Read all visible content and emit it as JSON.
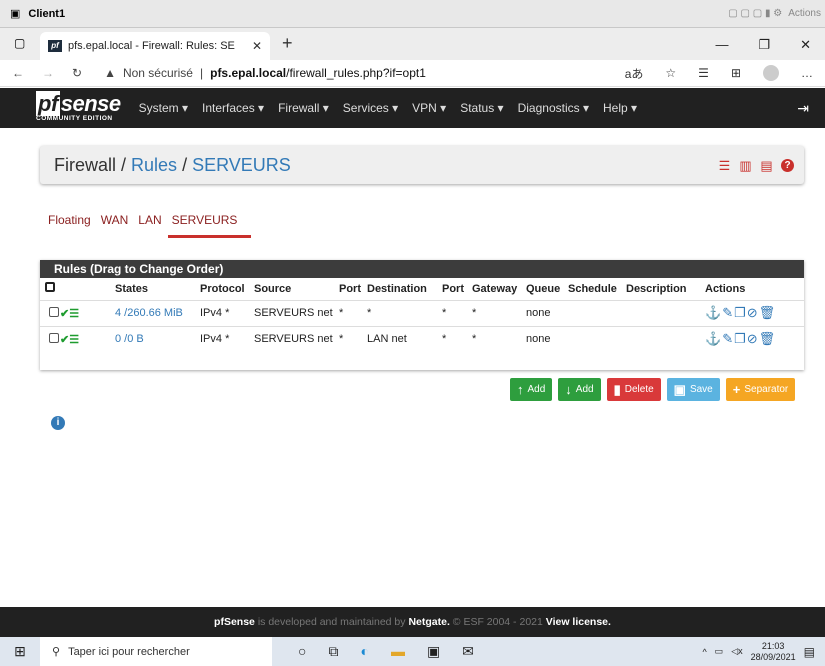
{
  "vm": {
    "title": "Client1",
    "actions": "Actions"
  },
  "browser": {
    "tab_title": "pfs.epal.local - Firewall: Rules: SE",
    "tab_favicon": "pf",
    "insecure_label": "Non sécurisé",
    "url_host": "pfs.epal.local",
    "url_path": "/firewall_rules.php?if=opt1"
  },
  "logo": {
    "name": "sense",
    "prefix": "pf",
    "edition": "COMMUNITY EDITION"
  },
  "nav": {
    "items": [
      "System ▾",
      "Interfaces ▾",
      "Firewall ▾",
      "Services ▾",
      "VPN ▾",
      "Status ▾",
      "Diagnostics ▾",
      "Help ▾"
    ]
  },
  "breadcrumb": {
    "root": "Firewall",
    "section": "Rules",
    "current": "SERVEURS",
    "sep": "/"
  },
  "subtabs": [
    "Floating",
    "WAN",
    "LAN",
    "SERVEURS"
  ],
  "panel": {
    "title": "Rules (Drag to Change Order)"
  },
  "columns": [
    "States",
    "Protocol",
    "Source",
    "Port",
    "Destination",
    "Port",
    "Gateway",
    "Queue",
    "Schedule",
    "Description",
    "Actions"
  ],
  "rules": [
    {
      "states": "4 /260.66 MiB",
      "protocol": "IPv4 *",
      "source": "SERVEURS net",
      "sport": "*",
      "destination": "*",
      "dport": "*",
      "gateway": "*",
      "queue": "none",
      "schedule": "",
      "description": ""
    },
    {
      "states": "0 /0 B",
      "protocol": "IPv4 *",
      "source": "SERVEURS net",
      "sport": "*",
      "destination": "LAN net",
      "dport": "*",
      "gateway": "*",
      "queue": "none",
      "schedule": "",
      "description": ""
    }
  ],
  "buttons": {
    "add_top": "Add",
    "add_bottom": "Add",
    "delete": "Delete",
    "save": "Save",
    "separator": "Separator"
  },
  "footer": {
    "brand": "pfSense",
    "text1": " is developed and maintained by ",
    "netgate": "Netgate.",
    "text2": " © ESF 2004 - 2021 ",
    "license": "View license."
  },
  "taskbar": {
    "search_placeholder": "Taper ici pour rechercher",
    "time": "21:03",
    "date": "28/09/2021"
  }
}
